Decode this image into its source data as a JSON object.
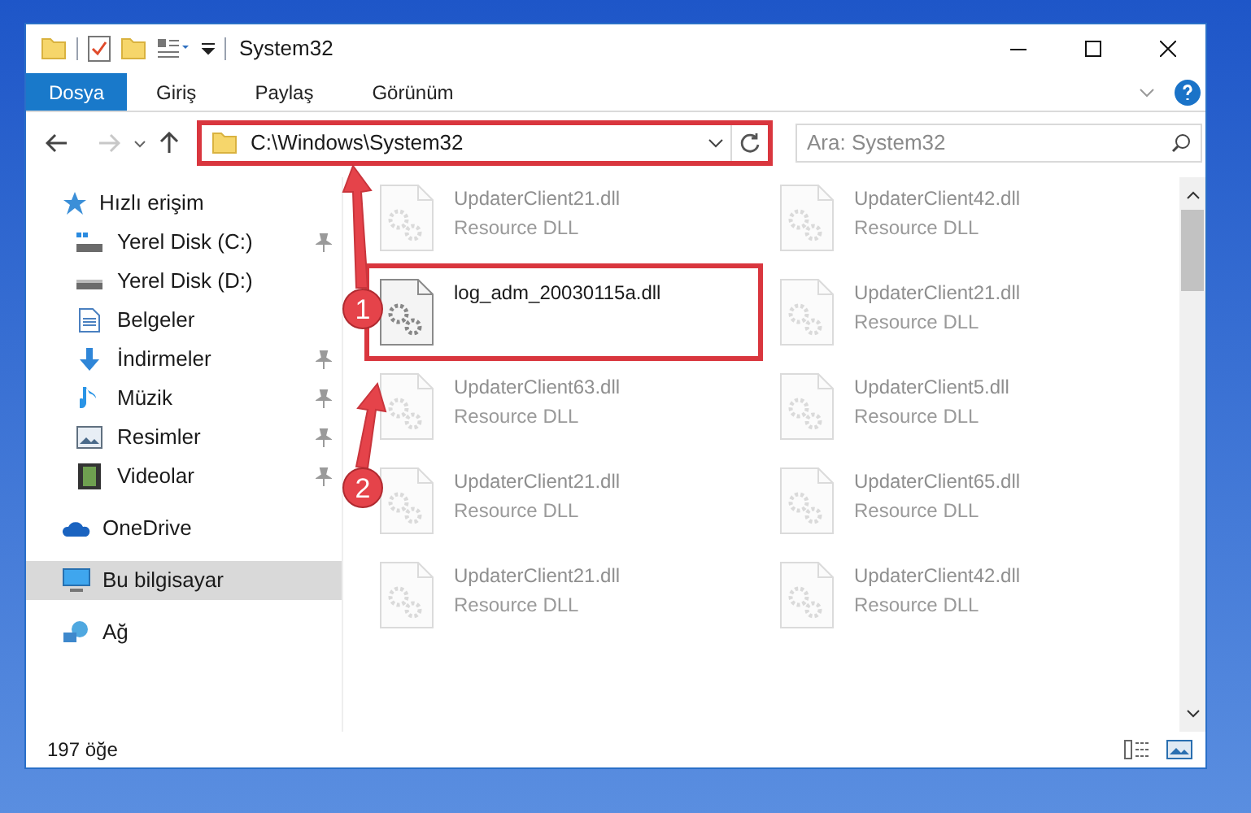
{
  "window": {
    "title": "System32"
  },
  "ribbon_tabs": [
    {
      "label": "Dosya",
      "selected": true
    },
    {
      "label": "Giriş",
      "selected": false
    },
    {
      "label": "Paylaş",
      "selected": false
    },
    {
      "label": "Görünüm",
      "selected": false
    }
  ],
  "address_bar": {
    "path": "C:\\Windows\\System32",
    "highlighted": true
  },
  "search": {
    "placeholder": "Ara: System32"
  },
  "sidebar": {
    "items": [
      {
        "label": "Hızlı erişim",
        "kind": "star",
        "selected": false,
        "children": [
          {
            "label": "Yerel Disk (C:)",
            "kind": "drive-c",
            "pinned": true
          },
          {
            "label": "Yerel Disk (D:)",
            "kind": "drive",
            "pinned": false
          },
          {
            "label": "Belgeler",
            "kind": "document",
            "pinned": false
          },
          {
            "label": "İndirmeler",
            "kind": "download",
            "pinned": true
          },
          {
            "label": "Müzik",
            "kind": "music",
            "pinned": true
          },
          {
            "label": "Resimler",
            "kind": "picture",
            "pinned": true
          },
          {
            "label": "Videolar",
            "kind": "film",
            "pinned": true
          }
        ]
      },
      {
        "label": "OneDrive",
        "kind": "cloud",
        "selected": false
      },
      {
        "label": "Bu bilgisayar",
        "kind": "computer",
        "selected": true
      },
      {
        "label": "Ağ",
        "kind": "network",
        "selected": false
      }
    ]
  },
  "files": [
    {
      "name": "UpdaterClient21.dll",
      "type": "Resource DLL",
      "dimmed": true,
      "highlighted": false
    },
    {
      "name": "UpdaterClient42.dll",
      "type": "Resource DLL",
      "dimmed": true,
      "highlighted": false
    },
    {
      "name": "log_adm_20030115a.dll",
      "dimmed": false,
      "highlighted": true
    },
    {
      "name": "UpdaterClient21.dll",
      "type": "Resource DLL",
      "dimmed": true,
      "highlighted": false
    },
    {
      "name": "UpdaterClient63.dll",
      "type": "Resource DLL",
      "dimmed": true,
      "highlighted": false
    },
    {
      "name": "UpdaterClient5.dll",
      "type": "Resource DLL",
      "dimmed": true,
      "highlighted": false
    },
    {
      "name": "UpdaterClient21.dll",
      "type": "Resource DLL",
      "dimmed": true,
      "highlighted": false
    },
    {
      "name": "UpdaterClient65.dll",
      "type": "Resource DLL",
      "dimmed": true,
      "highlighted": false
    },
    {
      "name": "UpdaterClient21.dll",
      "type": "Resource DLL",
      "dimmed": true,
      "highlighted": false
    },
    {
      "name": "UpdaterClient42.dll",
      "type": "Resource DLL",
      "dimmed": true,
      "highlighted": false
    }
  ],
  "status_bar": {
    "item_count": "197 öğe"
  },
  "annotations": [
    {
      "label": "1"
    },
    {
      "label": "2"
    }
  ]
}
